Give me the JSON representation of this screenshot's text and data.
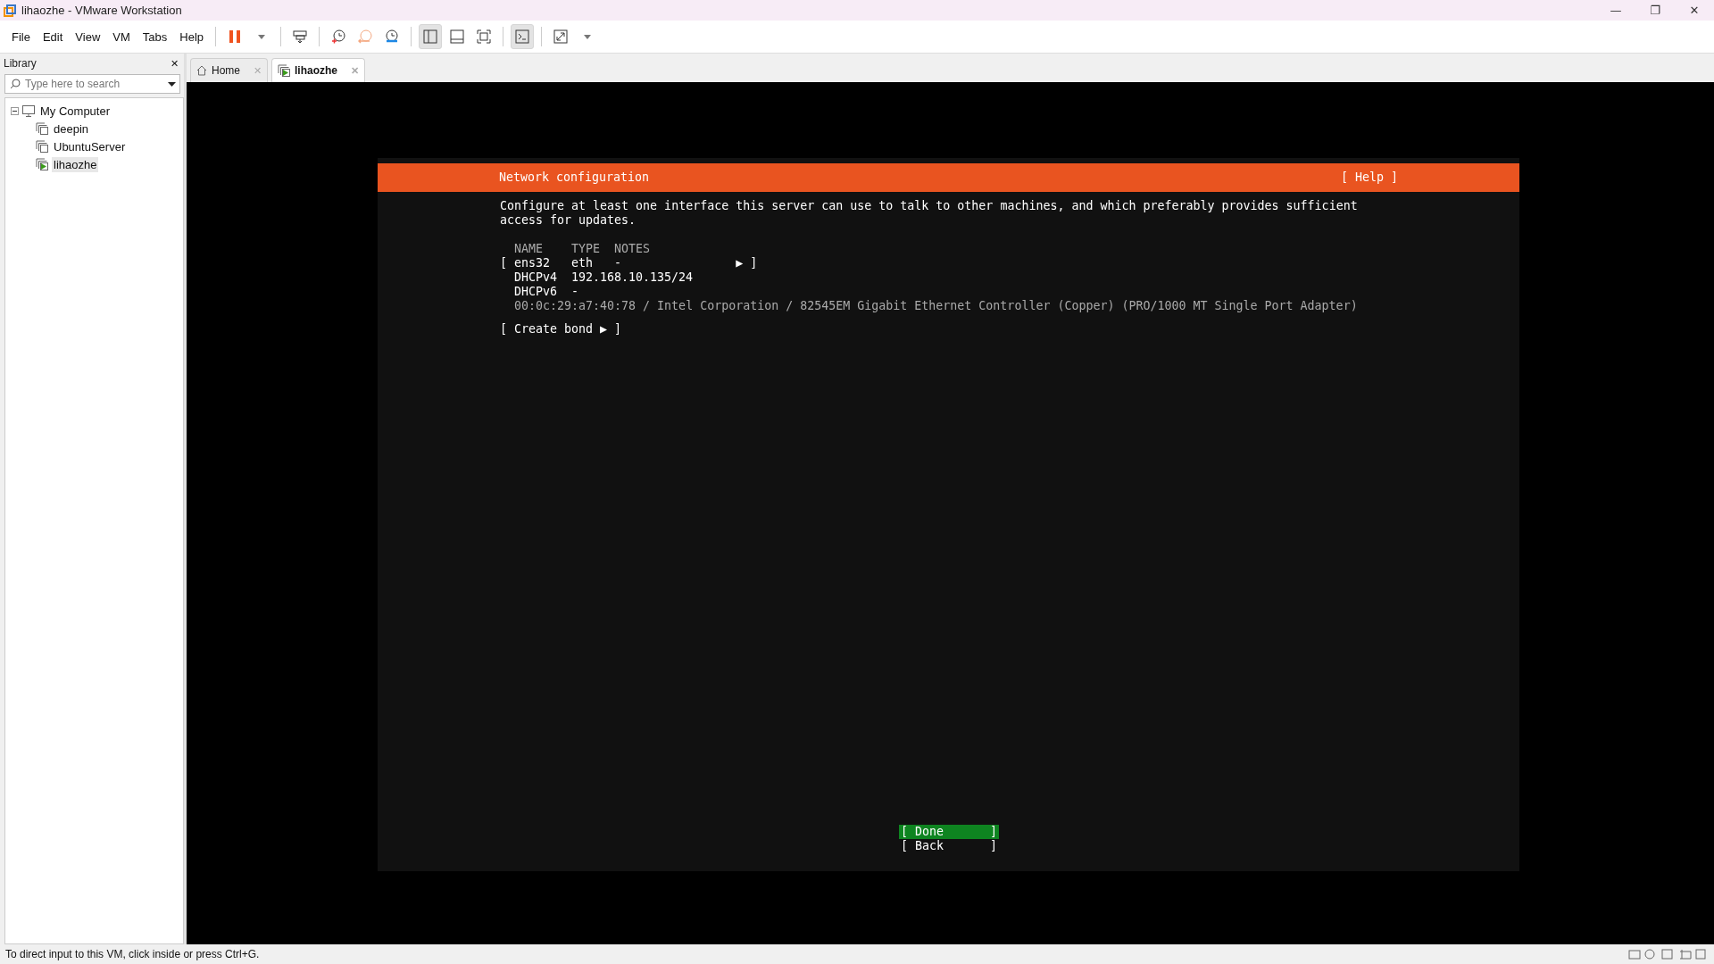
{
  "window": {
    "title": "lihaozhe - VMware Workstation",
    "controls": [
      "—",
      "❐",
      "✕"
    ]
  },
  "menu": [
    {
      "label": "File"
    },
    {
      "label": "Edit"
    },
    {
      "label": "View"
    },
    {
      "label": "VM"
    },
    {
      "label": "Tabs"
    },
    {
      "label": "Help"
    }
  ],
  "toolbar": [
    [
      {
        "kind": "pause",
        "active": false
      },
      {
        "kind": "caret",
        "active": false
      }
    ],
    [
      {
        "kind": "send",
        "active": false
      }
    ],
    [
      {
        "kind": "snap",
        "active": false
      },
      {
        "kind": "revert",
        "active": false
      },
      {
        "kind": "manage",
        "active": false
      }
    ],
    [
      {
        "kind": "sidebar",
        "active": true
      },
      {
        "kind": "thumb",
        "active": false
      },
      {
        "kind": "full",
        "active": false
      }
    ],
    [
      {
        "kind": "console",
        "active": true
      }
    ],
    [
      {
        "kind": "stretch",
        "active": false
      },
      {
        "kind": "caret",
        "active": false
      }
    ]
  ],
  "library": {
    "title": "Library",
    "close": "✕",
    "search": {
      "placeholder": "Type here to search"
    },
    "tree": [
      {
        "label": "My Computer",
        "kind": "computer",
        "expanded": true,
        "selected": false,
        "children": [
          {
            "label": "deepin",
            "kind": "vm",
            "running": false,
            "selected": false
          },
          {
            "label": "UbuntuServer",
            "kind": "vm",
            "running": false,
            "selected": false
          },
          {
            "label": "lihaozhe",
            "kind": "vm",
            "running": true,
            "selected": true
          }
        ]
      }
    ]
  },
  "tabs": [
    {
      "label": "Home",
      "kind": "home",
      "close": "✕",
      "selected": false
    },
    {
      "label": "lihaozhe",
      "kind": "vm",
      "close": "✕",
      "selected": true
    }
  ],
  "installer": {
    "title": "Network configuration",
    "help": "[ Help ]",
    "description": "Configure at least one interface this server can use to talk to other machines, and which preferably provides sufficient access for updates.",
    "columns": [
      "NAME",
      "TYPE",
      "NOTES"
    ],
    "interfaces": [
      {
        "open": "[",
        "name": "ens32",
        "type": "eth",
        "notes": "-",
        "action": "▶ ]",
        "addresses": [
          {
            "label": "DHCPv4",
            "value": "192.168.10.135/24"
          },
          {
            "label": "DHCPv6",
            "value": "-"
          }
        ],
        "details": "00:0c:29:a7:40:78 / Intel Corporation / 82545EM Gigabit Ethernet Controller (Copper) (PRO/1000 MT Single Port Adapter)"
      }
    ],
    "create_bond": "[ Create bond ▶ ]",
    "buttons": [
      {
        "open": "[",
        "label": "Done",
        "close": "]",
        "selected": true
      },
      {
        "open": "[",
        "label": "Back",
        "close": "]",
        "selected": false
      }
    ]
  },
  "status_bar": {
    "text": "To direct input to this VM, click inside or press Ctrl+G."
  }
}
